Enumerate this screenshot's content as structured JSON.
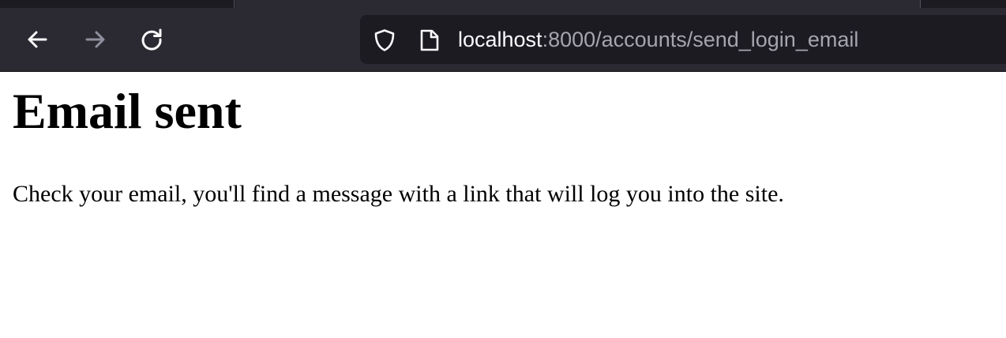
{
  "browser": {
    "nav": {
      "back_icon": "arrow-left-icon",
      "forward_icon": "arrow-right-icon",
      "reload_icon": "reload-icon"
    },
    "urlbar": {
      "security_icon": "shield-icon",
      "page_icon": "page-icon",
      "url_host": "localhost",
      "url_rest": ":8000/accounts/send_login_email"
    }
  },
  "page": {
    "heading": "Email sent",
    "message": "Check your email, you'll find a message with a link that will log you into the site."
  },
  "colors": {
    "toolbar_bg": "#2b2a33",
    "urlbar_bg": "#1c1b22",
    "url_host": "#fbfbfe",
    "url_path": "#a5a5ad"
  }
}
